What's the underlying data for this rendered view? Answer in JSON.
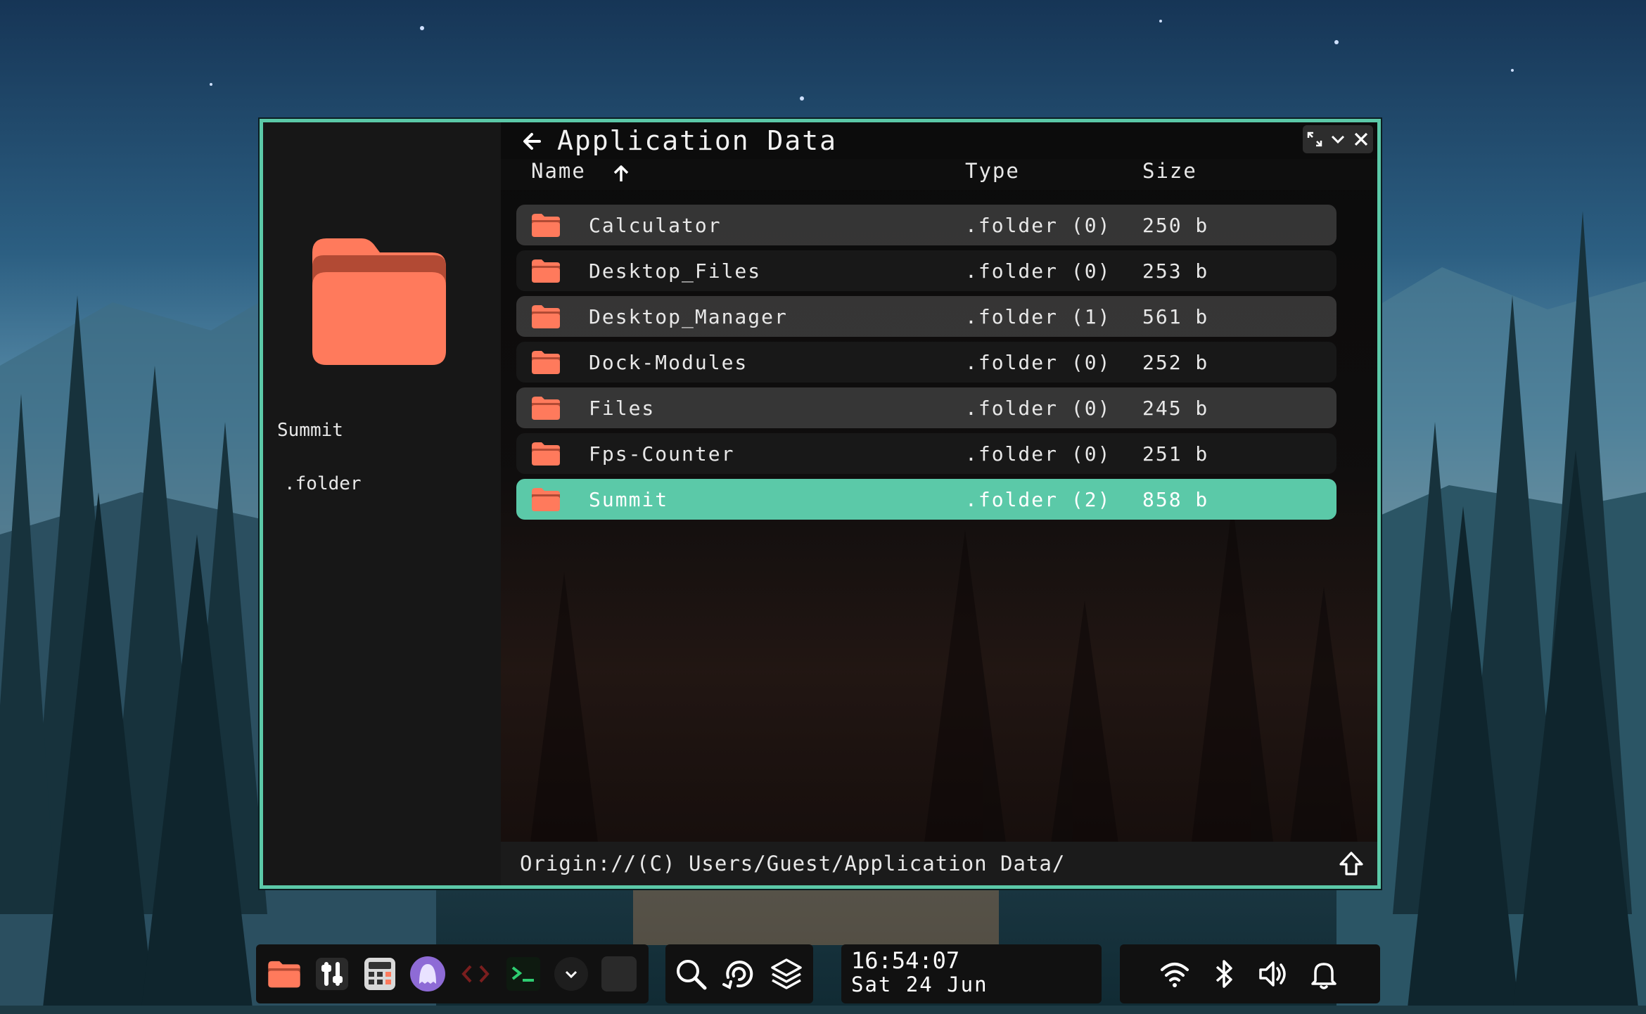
{
  "window": {
    "title": "Application Data",
    "columns": {
      "name": "Name",
      "type": "Type",
      "size": "Size"
    },
    "sort": {
      "column": "Name",
      "direction": "ascending"
    },
    "preview": {
      "name": "Summit",
      "type": ".folder"
    },
    "rows": [
      {
        "name": "Calculator",
        "type": ".folder (0)",
        "size": "250 b",
        "selected": false
      },
      {
        "name": "Desktop_Files",
        "type": ".folder (0)",
        "size": "253 b",
        "selected": false
      },
      {
        "name": "Desktop_Manager",
        "type": ".folder (1)",
        "size": "561 b",
        "selected": false
      },
      {
        "name": "Dock-Modules",
        "type": ".folder (0)",
        "size": "252 b",
        "selected": false
      },
      {
        "name": "Files",
        "type": ".folder (0)",
        "size": "245 b",
        "selected": false
      },
      {
        "name": "Fps-Counter",
        "type": ".folder (0)",
        "size": "251 b",
        "selected": false
      },
      {
        "name": "Summit",
        "type": ".folder (2)",
        "size": "858 b",
        "selected": true
      }
    ],
    "path": "Origin://(C) Users/Guest/Application Data/"
  },
  "dock": {
    "apps": [
      {
        "name": "files-app-icon"
      },
      {
        "name": "settings-sliders-icon"
      },
      {
        "name": "calculator-icon"
      },
      {
        "name": "ghost-app-icon"
      },
      {
        "name": "code-editor-icon"
      },
      {
        "name": "terminal-icon"
      },
      {
        "name": "chevron-down-icon"
      },
      {
        "name": "empty-slot"
      }
    ],
    "tools": [
      {
        "name": "search-icon"
      },
      {
        "name": "refresh-icon"
      },
      {
        "name": "layers-icon"
      }
    ],
    "clock": {
      "time": "16:54:07",
      "date": "Sat 24 Jun"
    },
    "status": [
      {
        "name": "wifi-icon"
      },
      {
        "name": "bluetooth-icon"
      },
      {
        "name": "volume-icon"
      },
      {
        "name": "bell-icon"
      }
    ]
  },
  "colors": {
    "accent": "#5bc9a8",
    "folder": "#ff7a5c",
    "folder_dark": "#b24a34",
    "window_bg": "#161616",
    "dock_bg": "#111111"
  }
}
